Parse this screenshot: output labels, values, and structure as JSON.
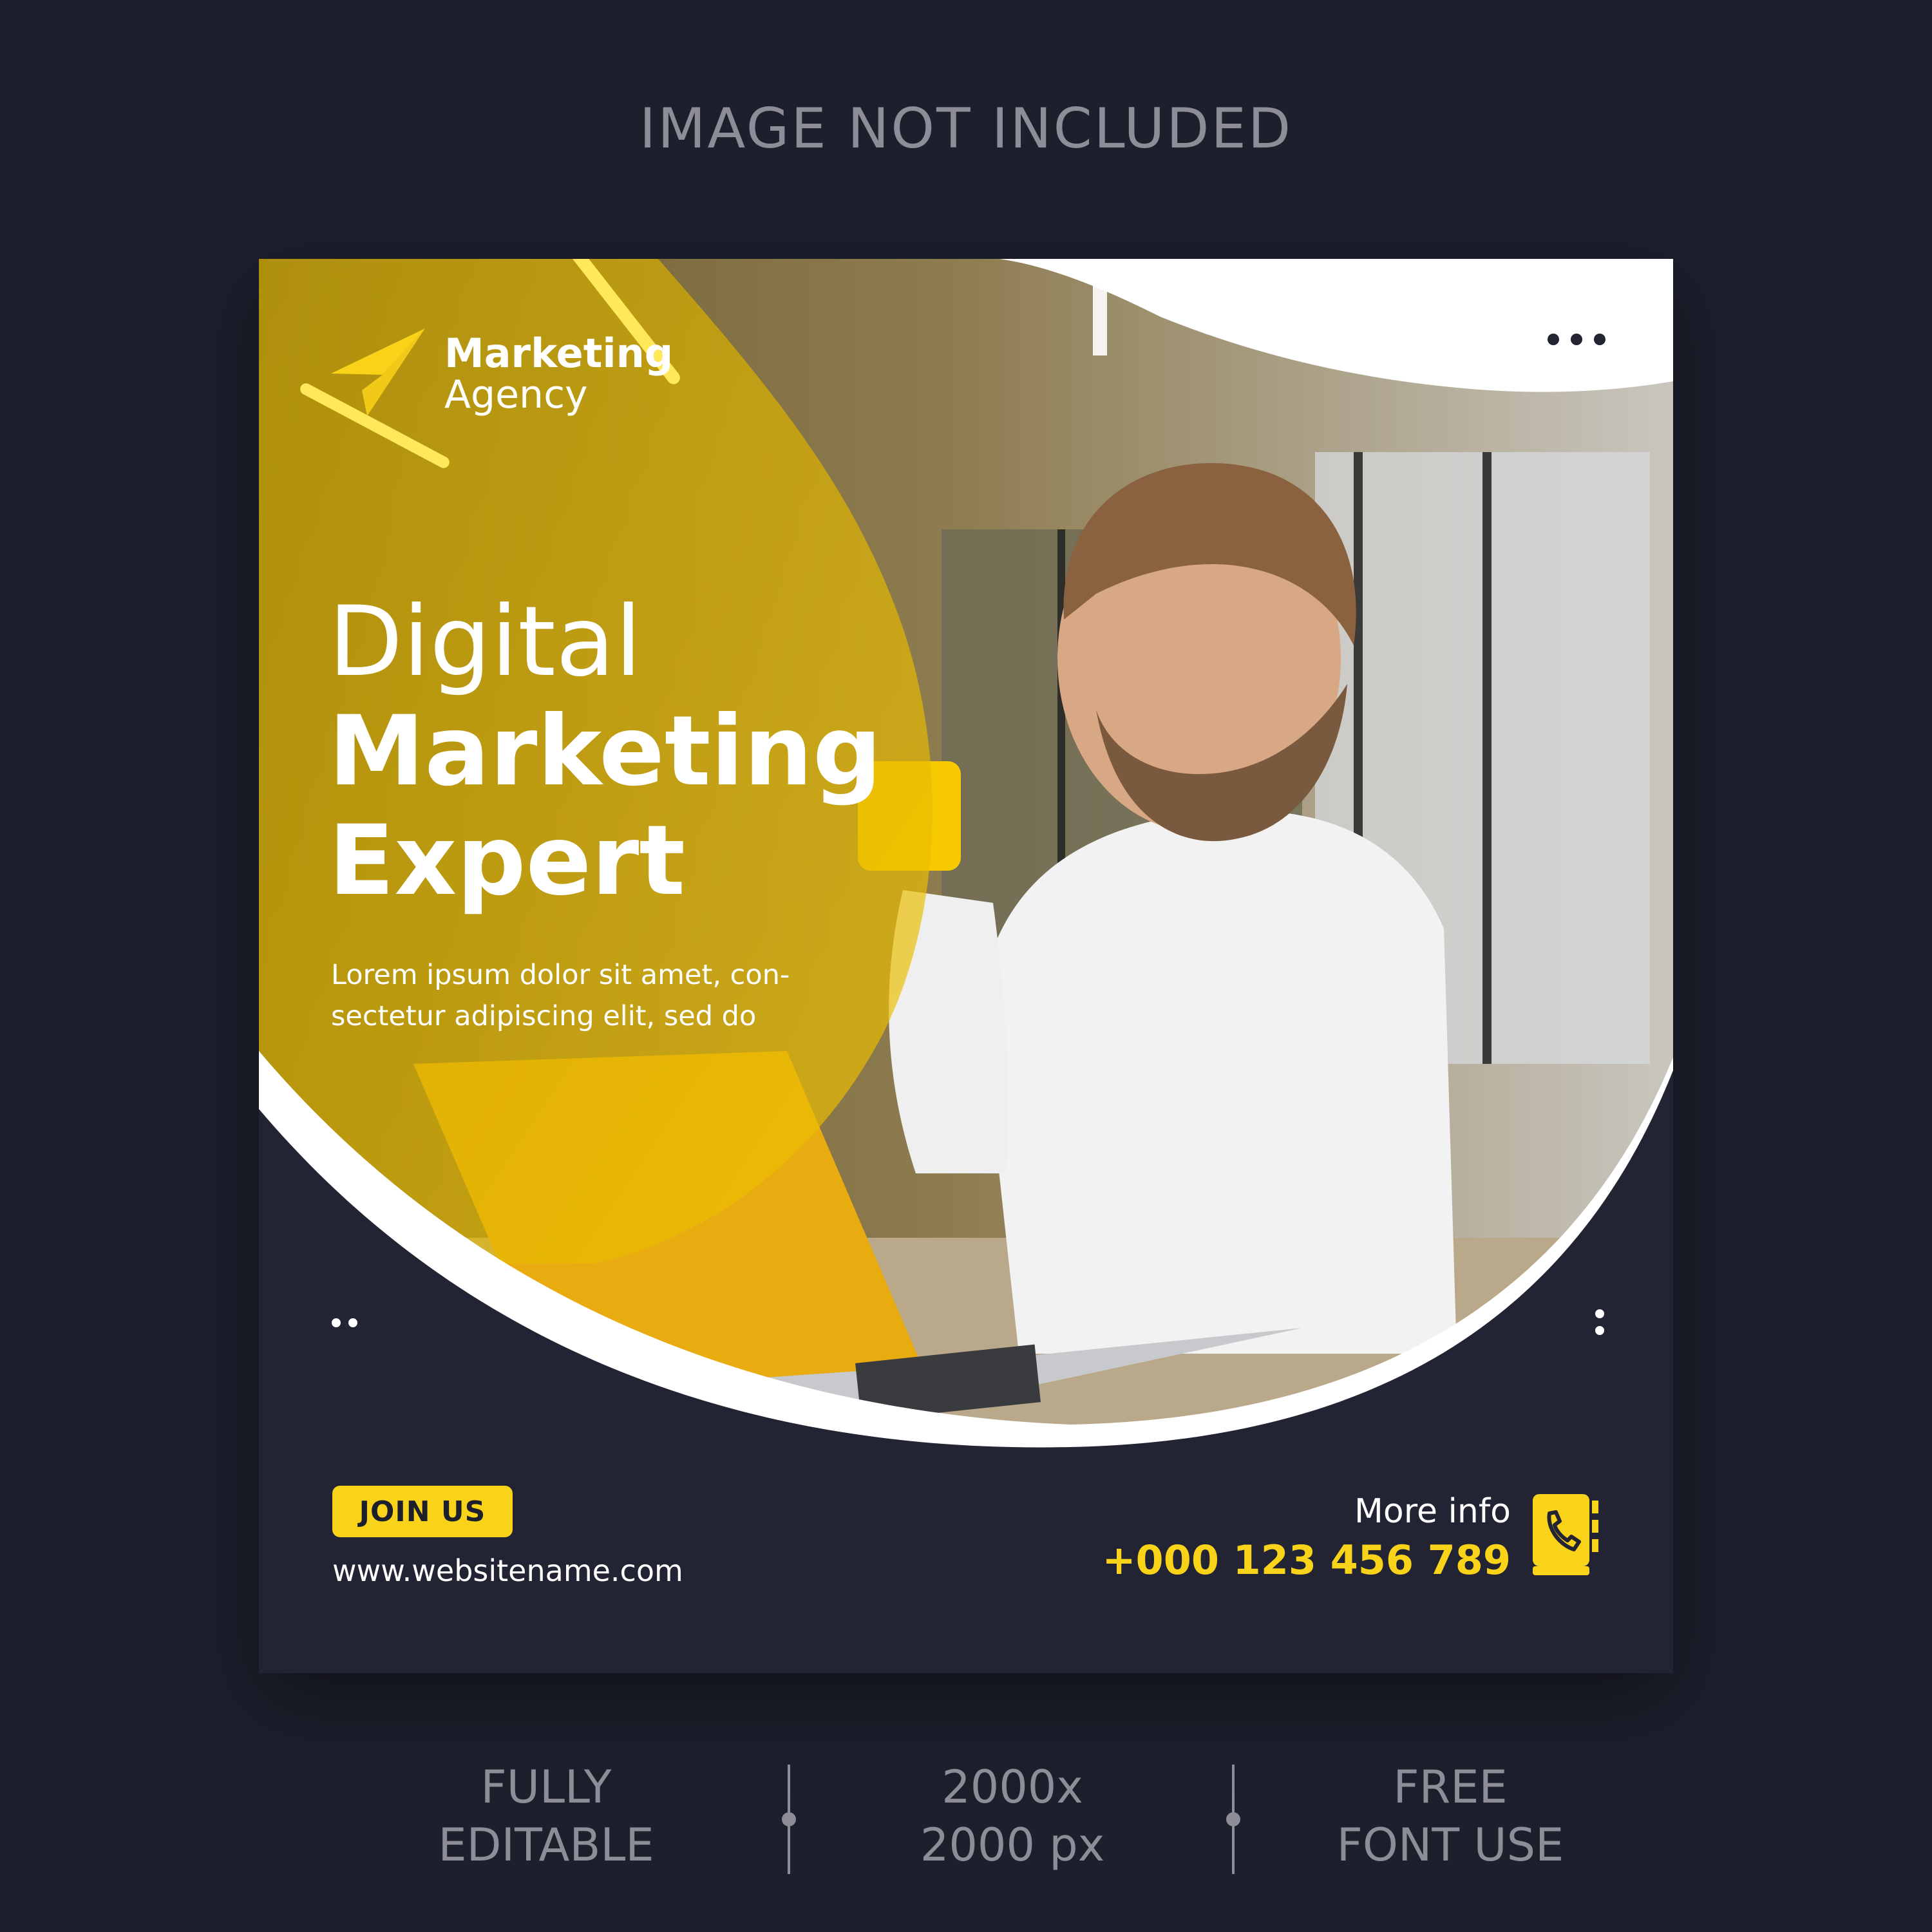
{
  "banner": {
    "text": "IMAGE NOT INCLUDED"
  },
  "brand": {
    "line1": "Marketing",
    "line2": "Agency",
    "icon": "paper-plane-icon"
  },
  "headline": {
    "line1": "Digital",
    "line2": "Marketing",
    "line3": "Expert"
  },
  "description": {
    "line1": "Lorem ipsum dolor sit amet, con-",
    "line2": "sectetur adipiscing elit, sed do"
  },
  "cta": {
    "label": "JOIN US",
    "website": "www.websitename.com"
  },
  "contact": {
    "label": "More info",
    "phone": "+000 123 456 789",
    "icon": "phone-book-icon"
  },
  "features": [
    {
      "line1": "FULLY",
      "line2": "EDITABLE"
    },
    {
      "line1": "2000x",
      "line2": "2000 px"
    },
    {
      "line1": "FREE",
      "line2": "FONT USE"
    }
  ],
  "colors": {
    "accent": "#f9d21a",
    "background": "#1d1f2d",
    "card": "#222333",
    "muted": "#8c8d96"
  }
}
